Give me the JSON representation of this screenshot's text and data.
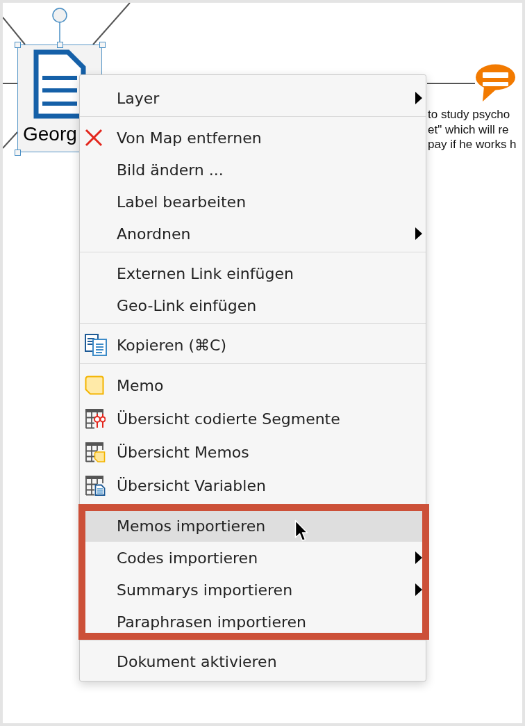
{
  "canvas": {
    "node": {
      "label": "Georg",
      "selected": true
    },
    "note_text": {
      "lines": [
        "to study psycho",
        "et\" which will re",
        "pay if he works h"
      ]
    }
  },
  "context_menu": {
    "groups": [
      {
        "framed": false,
        "items": [
          {
            "label": "Layer",
            "kind": "text",
            "submenu": true,
            "selected": false
          }
        ]
      },
      {
        "framed": false,
        "items": [
          {
            "label": "Von Map entfernen",
            "kind": "remove",
            "submenu": false,
            "selected": false
          },
          {
            "label": "Bild ändern ...",
            "kind": "text",
            "submenu": false,
            "selected": false
          },
          {
            "label": "Label bearbeiten",
            "kind": "text",
            "submenu": false,
            "selected": false
          },
          {
            "label": "Anordnen",
            "kind": "text",
            "submenu": true,
            "selected": false
          }
        ]
      },
      {
        "framed": false,
        "items": [
          {
            "label": "Externen Link einfügen",
            "kind": "text",
            "submenu": false,
            "selected": false
          },
          {
            "label": "Geo-Link einfügen",
            "kind": "text",
            "submenu": false,
            "selected": false
          }
        ]
      },
      {
        "framed": false,
        "items": [
          {
            "label": "Kopieren (⌘C)",
            "kind": "copy",
            "submenu": false,
            "selected": false
          }
        ]
      },
      {
        "framed": false,
        "items": [
          {
            "label": "Memo",
            "kind": "memo",
            "submenu": false,
            "selected": false
          },
          {
            "label": "Übersicht codierte Segmente",
            "kind": "segments",
            "submenu": false,
            "selected": false
          },
          {
            "label": "Übersicht Memos",
            "kind": "memos",
            "submenu": false,
            "selected": false
          },
          {
            "label": "Übersicht Variablen",
            "kind": "variables",
            "submenu": false,
            "selected": false
          }
        ]
      },
      {
        "framed": true,
        "items": [
          {
            "label": "Memos importieren",
            "kind": "text",
            "submenu": false,
            "selected": true
          },
          {
            "label": "Codes importieren",
            "kind": "text",
            "submenu": true,
            "selected": false
          },
          {
            "label": "Summarys importieren",
            "kind": "text",
            "submenu": true,
            "selected": false
          },
          {
            "label": "Paraphrasen importieren",
            "kind": "text",
            "submenu": false,
            "selected": false
          }
        ]
      },
      {
        "framed": false,
        "items": [
          {
            "label": "Dokument aktivieren",
            "kind": "text",
            "submenu": false,
            "selected": false
          }
        ]
      }
    ]
  }
}
